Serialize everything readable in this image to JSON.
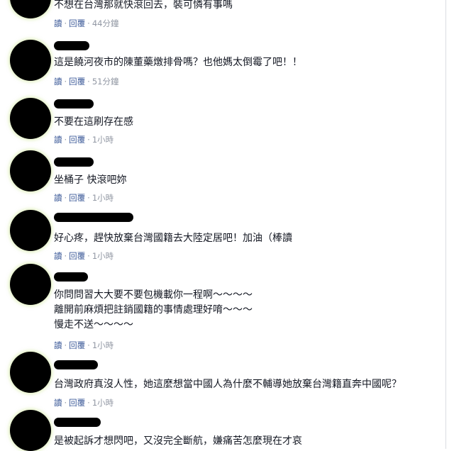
{
  "comments": [
    {
      "lines": [
        "不想在台灣那就快滾回去，裝可憐有事嗎"
      ],
      "meta": {
        "read": "讀",
        "reply": "回覆",
        "time": "44分鐘"
      }
    },
    {
      "lines": [
        "這是饒河夜市的陳董藥燉排骨嗎？也他媽太倒霉了吧！！"
      ],
      "meta": {
        "read": "讀",
        "reply": "回覆",
        "time": "51分鐘"
      }
    },
    {
      "lines": [
        "不要在這刷存在感"
      ],
      "meta": {
        "read": "讀",
        "reply": "回覆",
        "time": "1小時"
      }
    },
    {
      "lines": [
        "坐桶子 快滾吧妳"
      ],
      "meta": {
        "read": "讀",
        "reply": "回覆",
        "time": "1小時"
      }
    },
    {
      "lines": [
        "好心疼，趕快放棄台灣國籍去大陸定居吧！加油（棒讀"
      ],
      "meta": {
        "read": "讀",
        "reply": "回覆",
        "time": "1小時"
      }
    },
    {
      "lines": [
        "你問問習大大要不要包機載你一程啊～～～～",
        "離開前麻煩把註銷國籍的事情處理好唷～～～",
        "慢走不送～～～～"
      ],
      "meta": {
        "read": "讀",
        "reply": "回覆",
        "time": "1小時"
      }
    },
    {
      "lines": [
        "台灣政府真沒人性，她這麼想當中國人為什麼不輔導她放棄台灣籍直奔中國呢？"
      ],
      "meta": {
        "read": "讀",
        "reply": "回覆",
        "time": "1小時"
      }
    },
    {
      "lines": [
        "是被起訴才想閃吧，又沒完全斷航，嫌痛苦怎麼現在才哀"
      ],
      "meta": null
    }
  ]
}
